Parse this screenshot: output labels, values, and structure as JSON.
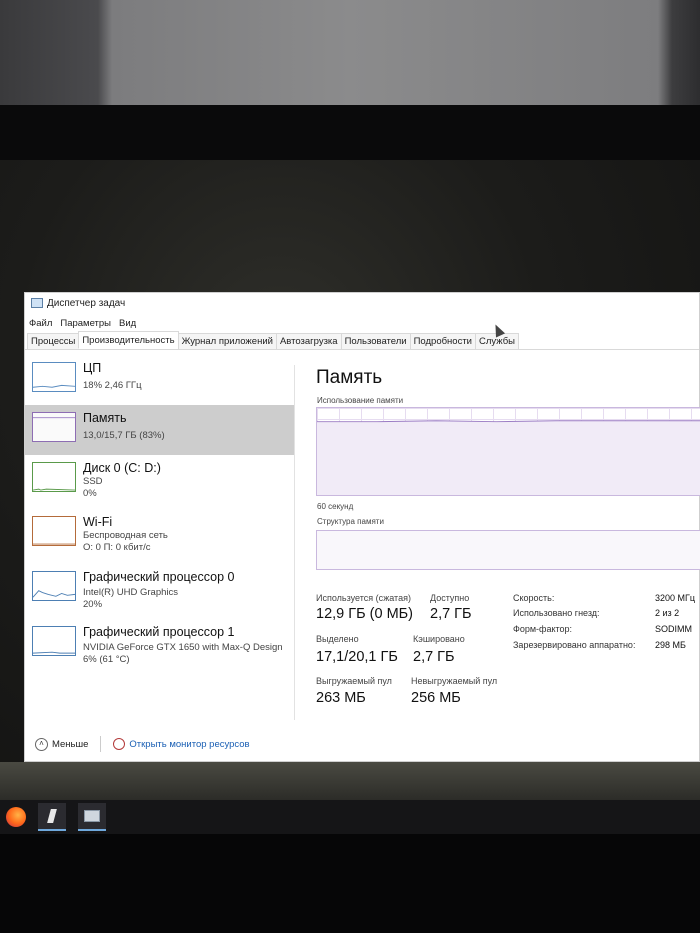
{
  "window": {
    "title": "Диспетчер задач",
    "menu": [
      "Файл",
      "Параметры",
      "Вид"
    ],
    "tabs": [
      "Процессы",
      "Производительность",
      "Журнал приложений",
      "Автозагрузка",
      "Пользователи",
      "Подробности",
      "Службы"
    ],
    "active_tab": "Производительность"
  },
  "resources": [
    {
      "name": "ЦП",
      "sub1": "18% 2,46 ГГц",
      "sub2": "",
      "sub3": ""
    },
    {
      "name": "Память",
      "sub1": "13,0/15,7 ГБ (83%)",
      "sub2": "",
      "sub3": ""
    },
    {
      "name": "Диск 0 (C: D:)",
      "sub1": "SSD",
      "sub2": "0%",
      "sub3": ""
    },
    {
      "name": "Wi-Fi",
      "sub1": "Беспроводная сеть",
      "sub2": "О: 0 П: 0 кбит/с",
      "sub3": ""
    },
    {
      "name": "Графический процессор 0",
      "sub1": "Intel(R) UHD Graphics",
      "sub2": "20%",
      "sub3": ""
    },
    {
      "name": "Графический процессор 1",
      "sub1": "NVIDIA GeForce GTX 1650 with Max-Q Design",
      "sub2": "6% (61 °C)",
      "sub3": ""
    }
  ],
  "detail": {
    "title": "Память",
    "usage_label": "Использование памяти",
    "time_label": "60 секунд",
    "composition_label": "Структура памяти",
    "stats": {
      "in_use_label": "Используется (сжатая)",
      "in_use_value": "12,9 ГБ (0 МБ)",
      "available_label": "Доступно",
      "available_value": "2,7 ГБ",
      "committed_label": "Выделено",
      "committed_value": "17,1/20,1 ГБ",
      "cached_label": "Кэшировано",
      "cached_value": "2,7 ГБ",
      "paged_label": "Выгружаемый пул",
      "paged_value": "263 МБ",
      "nonpaged_label": "Невыгружаемый пул",
      "nonpaged_value": "256 МБ"
    },
    "specs": {
      "speed_label": "Скорость:",
      "speed_value": "3200 МГц",
      "slots_label": "Использовано гнезд:",
      "slots_value": "2 из 2",
      "form_label": "Форм-фактор:",
      "form_value": "SODIMM",
      "reserved_label": "Зарезервировано аппаратно:",
      "reserved_value": "298 МБ"
    }
  },
  "footer": {
    "less_label": "Меньше",
    "monitor_label": "Открыть монитор ресурсов"
  },
  "colors": {
    "memory_graph_line": "#9b7cc4",
    "link": "#1a5fb4",
    "selected_row": "#cdcdcd"
  }
}
